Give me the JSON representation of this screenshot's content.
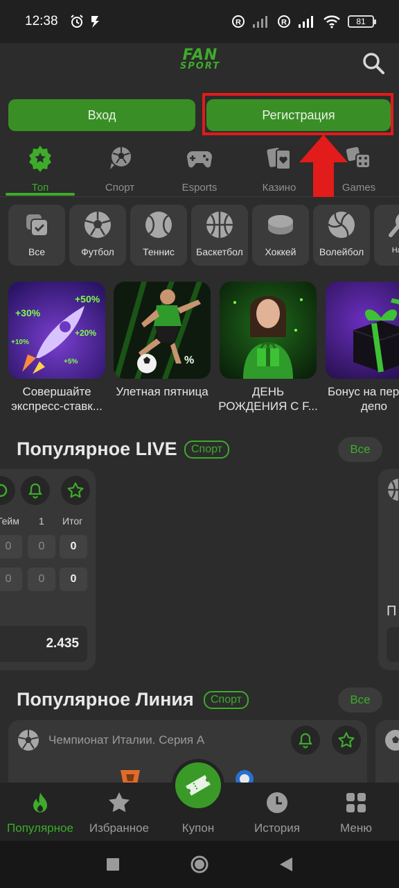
{
  "status_bar": {
    "time": "12:38",
    "battery": "81"
  },
  "header": {
    "logo_line1": "FAN",
    "logo_line2": "SPORT"
  },
  "auth": {
    "login_label": "Вход",
    "register_label": "Регистрация"
  },
  "tabs": [
    {
      "label": "Топ",
      "icon": "star-badge-icon"
    },
    {
      "label": "Спорт",
      "icon": "soccer-ball-icon"
    },
    {
      "label": "Esports",
      "icon": "gamepad-icon"
    },
    {
      "label": "Казино",
      "icon": "cards-icon"
    },
    {
      "label": "Games",
      "icon": "dice-icon"
    }
  ],
  "sports": [
    {
      "label": "Все"
    },
    {
      "label": "Футбол"
    },
    {
      "label": "Теннис"
    },
    {
      "label": "Баскетбол"
    },
    {
      "label": "Хоккей"
    },
    {
      "label": "Волейбол"
    },
    {
      "label": "Насто"
    }
  ],
  "promos": [
    {
      "title": "Совершайте экспресс-ставк...",
      "badges": [
        "+30%",
        "+50%",
        "+10%",
        "+20%",
        "+5%"
      ]
    },
    {
      "title": "Улетная пятница",
      "badges": [
        "%"
      ]
    },
    {
      "title": "ДЕНЬ РОЖДЕНИЯ С F..."
    },
    {
      "title": "Бонус на первый депо"
    }
  ],
  "popular_live": {
    "title": "Популярное LIVE",
    "badge": "Спорт",
    "all_label": "Все",
    "columns": [
      "Гейм",
      "1",
      "Итог"
    ],
    "rows": [
      [
        "0",
        "0",
        "0"
      ],
      [
        "0",
        "0",
        "0"
      ]
    ],
    "odd": "2.435",
    "right_card_letter": "П"
  },
  "popular_line": {
    "title": "Популярное Линия",
    "badge": "Спорт",
    "all_label": "Все",
    "league": "Чемпионат Италии. Серия А"
  },
  "bottom_nav": [
    {
      "label": "Популярное",
      "icon": "flame-icon"
    },
    {
      "label": "Избранное",
      "icon": "star-icon"
    },
    {
      "label": "Купон",
      "icon": "ticket-icon"
    },
    {
      "label": "История",
      "icon": "clock-icon"
    },
    {
      "label": "Меню",
      "icon": "grid-icon"
    }
  ],
  "colors": {
    "accent": "#3eab2b",
    "background": "#2b2c2b",
    "highlight": "#e21b1b"
  }
}
